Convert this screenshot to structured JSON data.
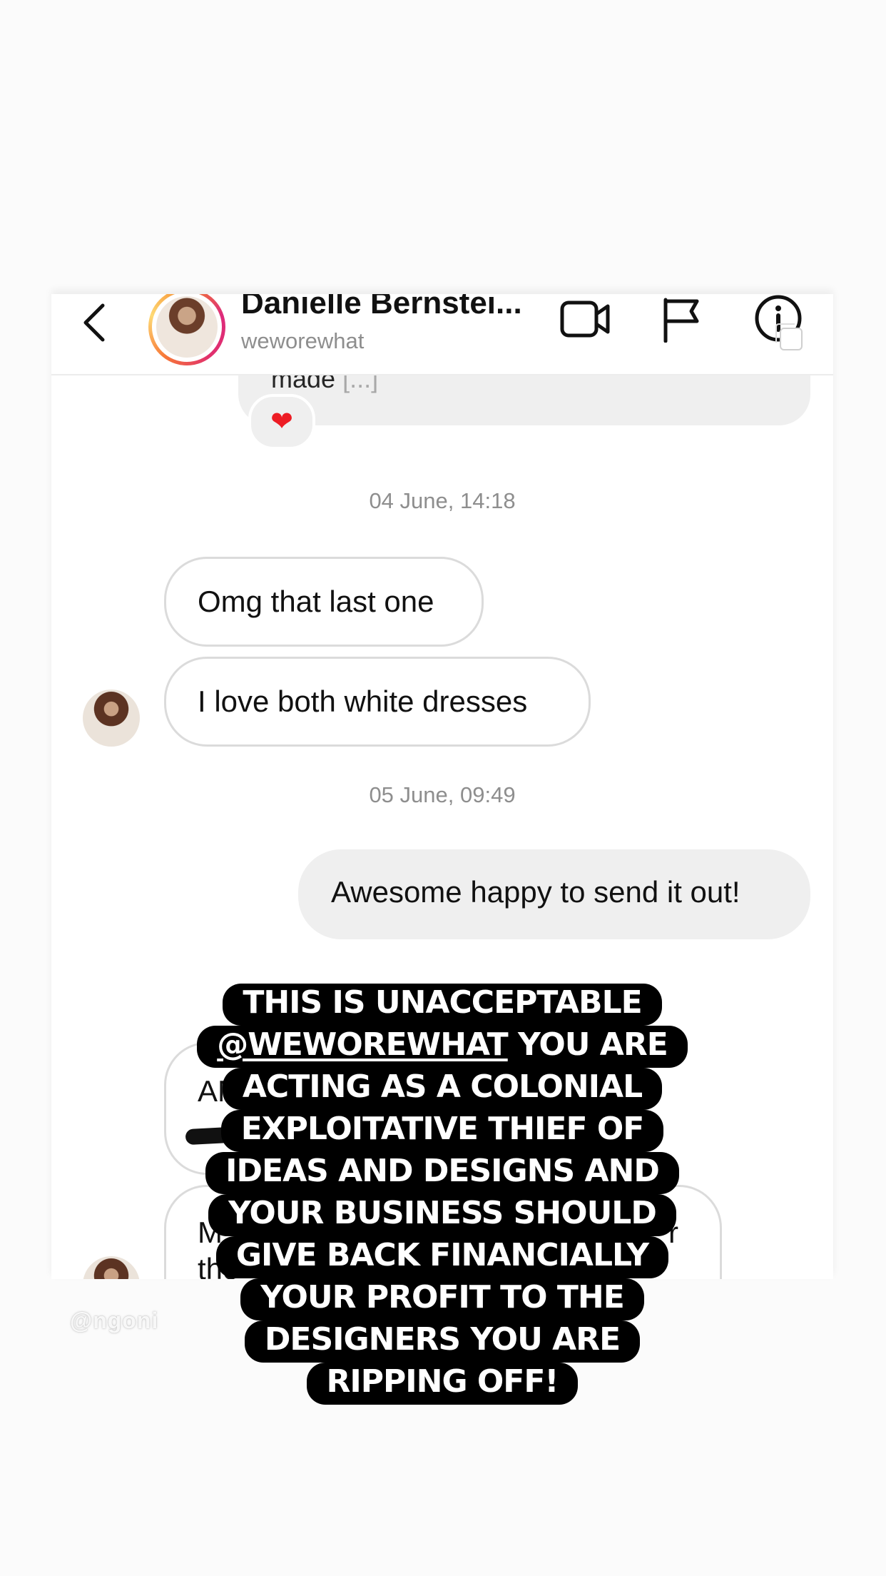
{
  "header": {
    "display_name": "Danielle Bernstei...",
    "username": "weworewhat"
  },
  "messages": {
    "previous_preview": "made",
    "previous_ellipsis": "[...]",
    "reaction": "❤",
    "groups": [
      {
        "timestamp": "04 June, 14:18"
      },
      {
        "timestamp": "05 June, 09:49"
      }
    ],
    "incoming_1": "Omg that last one",
    "incoming_2": "I love both white dresses",
    "outgoing_1": "Awesome happy to send it out!",
    "partial_a_line1": "AM",
    "partial_b_line1": "M",
    "partial_b_line2": "the",
    "partial_b_right": "r"
  },
  "watermark": "@ngoni",
  "caption": {
    "line1": "THIS IS UNACCEPTABLE",
    "line2_mention": "@WEWOREWHAT",
    "line2_rest": " YOU ARE",
    "line3": "ACTING AS A COLONIAL",
    "line4": "EXPLOITATIVE THIEF OF",
    "line5": "IDEAS AND DESIGNS AND",
    "line6": "YOUR BUSINESS SHOULD",
    "line7": "GIVE BACK FINANCIALLY",
    "line8": "YOUR PROFIT TO THE",
    "line9": "DESIGNERS YOU ARE",
    "line10": "RIPPING OFF!"
  },
  "colors": {
    "story_bg": "#fbfbfb",
    "outgoing_bubble": "#efefef",
    "incoming_border": "#dbdbdb",
    "caption_bg": "#000000",
    "caption_text": "#ffffff",
    "meta_text": "#8e8e8e"
  }
}
